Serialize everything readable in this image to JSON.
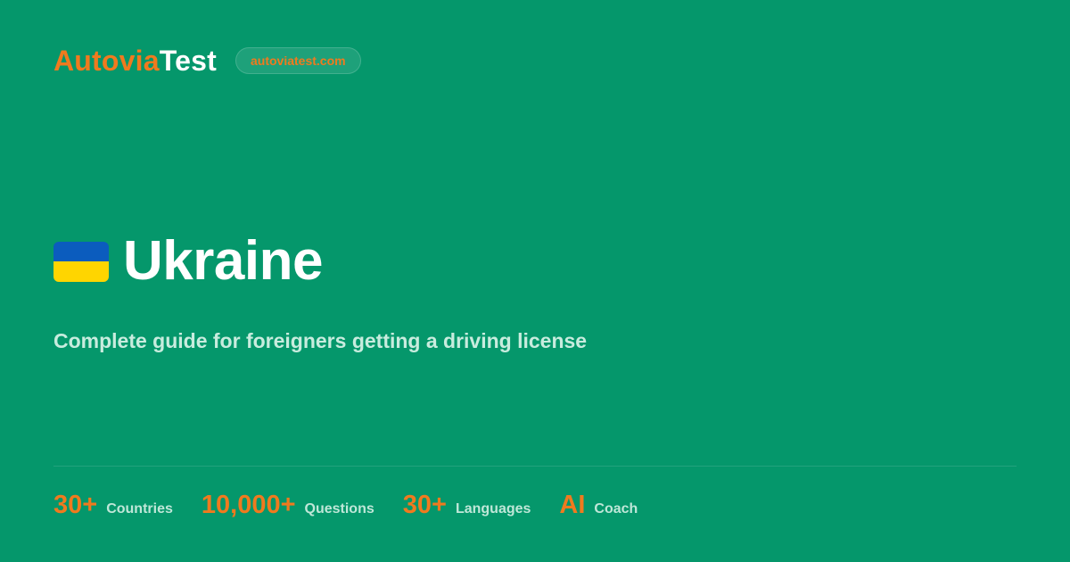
{
  "brand": {
    "logo_part_a": "Autovia",
    "logo_part_b": "Test",
    "domain": "autoviatest.com",
    "accent_color": "#f07a1e",
    "background_color": "#05976b"
  },
  "hero": {
    "flag_icon": "ukraine-flag-icon",
    "title": "Ukraine",
    "subtitle": "Complete guide for foreigners getting a driving license"
  },
  "stats": [
    {
      "value": "30+",
      "label": "Countries"
    },
    {
      "value": "10,000+",
      "label": "Questions"
    },
    {
      "value": "30+",
      "label": "Languages"
    },
    {
      "value": "AI",
      "label": "Coach"
    }
  ]
}
